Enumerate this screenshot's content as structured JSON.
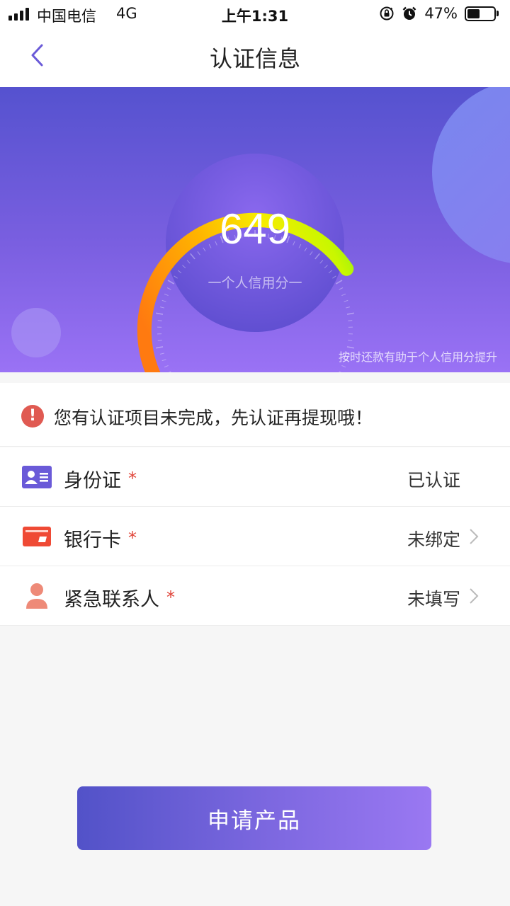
{
  "status_bar": {
    "carrier": "中国电信",
    "network": "4G",
    "time": "上午1:31",
    "battery_percent": "47%",
    "battery_level": 0.47,
    "icons": [
      "signal-icon",
      "rotation-lock-icon",
      "alarm-icon",
      "battery-icon"
    ]
  },
  "header": {
    "title": "认证信息",
    "back_icon": "chevron-left-icon"
  },
  "credit": {
    "score": "649",
    "label": "一个人信用分一",
    "tip": "按时还款有助于个人信用分提升"
  },
  "notice": {
    "icon": "exclamation-icon",
    "text": "您有认证项目未完成，先认证再提现哦！"
  },
  "items": [
    {
      "label": "身份证",
      "required_mark": "*",
      "status": "已认证",
      "icon": "id-card-icon",
      "has_chevron": false
    },
    {
      "label": "银行卡",
      "required_mark": "*",
      "status": "未绑定",
      "icon": "bank-card-icon",
      "has_chevron": true
    },
    {
      "label": "紧急联系人",
      "required_mark": "*",
      "status": "未填写",
      "icon": "contact-person-icon",
      "has_chevron": true
    }
  ],
  "apply_button": {
    "label": "申请产品"
  },
  "colors": {
    "accent": "#6a5ad8",
    "required": "#e0453a",
    "notice_icon": "#e05a52",
    "id_icon": "#6a5ad8",
    "bank_icon": "#ef4a35",
    "contact_icon": "#ee8a78"
  }
}
